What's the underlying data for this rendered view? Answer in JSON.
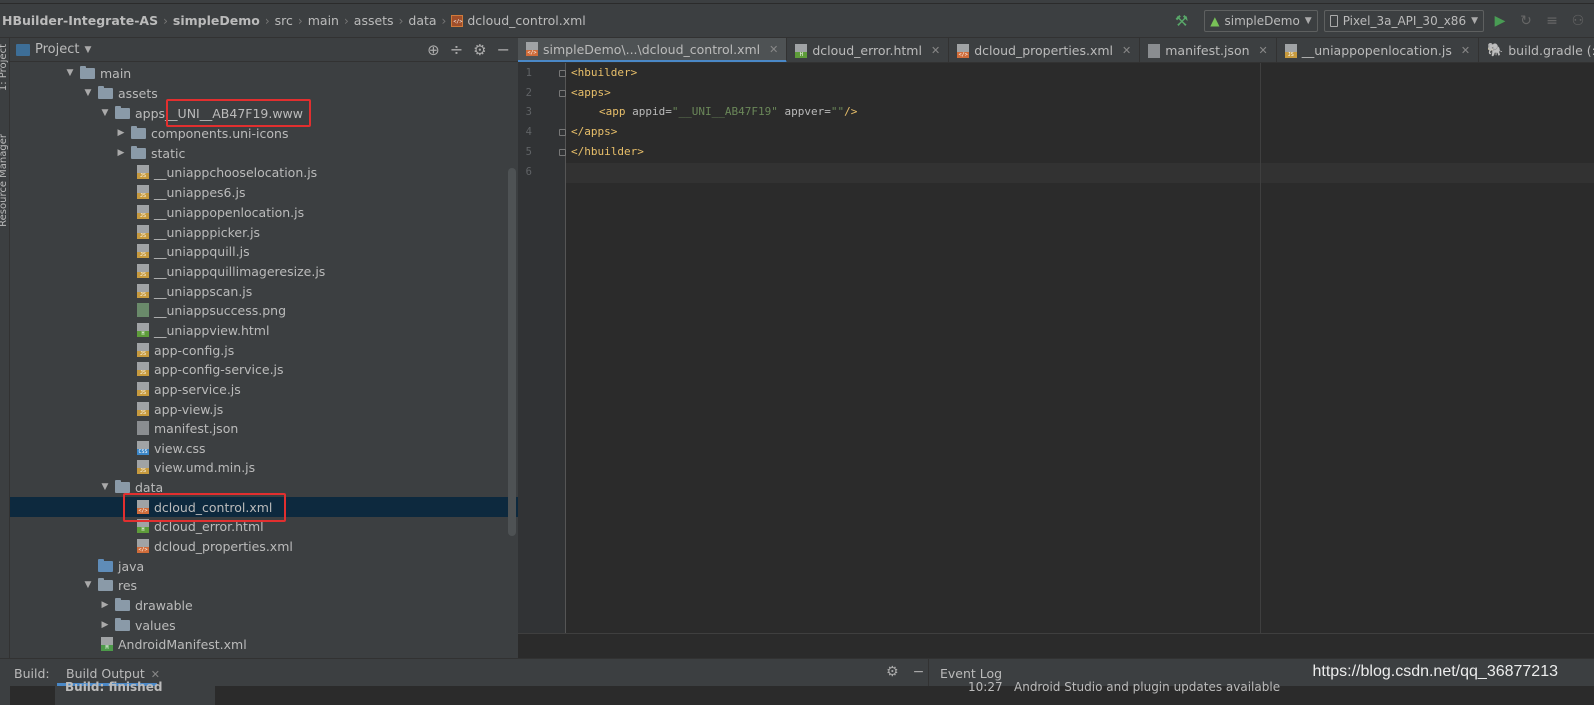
{
  "breadcrumbs": [
    {
      "label": "HBuilder-Integrate-AS",
      "bold": true
    },
    {
      "label": "simpleDemo",
      "bold": true
    },
    {
      "label": "src"
    },
    {
      "label": "main"
    },
    {
      "label": "assets"
    },
    {
      "label": "data"
    },
    {
      "label": "dcloud_control.xml"
    }
  ],
  "toolbar": {
    "run_config": "simpleDemo",
    "device": "Pixel_3a_API_30_x86"
  },
  "left_strip": {
    "project_label": "1: Project",
    "resource_label": "Resource Manager"
  },
  "project_panel": {
    "title": "Project"
  },
  "tree": [
    {
      "label": "main",
      "type": "folder"
    },
    {
      "label": "assets",
      "type": "folder"
    },
    {
      "label": "apps",
      "suffix": "__UNI__AB47F19.www",
      "type": "folder"
    },
    {
      "label": "components.uni-icons",
      "type": "folder"
    },
    {
      "label": "static",
      "type": "folder"
    },
    {
      "label": "__uniappchooselocation.js",
      "type": "js"
    },
    {
      "label": "__uniappes6.js",
      "type": "js"
    },
    {
      "label": "__uniappopenlocation.js",
      "type": "js"
    },
    {
      "label": "__uniapppicker.js",
      "type": "js"
    },
    {
      "label": "__uniappquill.js",
      "type": "js"
    },
    {
      "label": "__uniappquillimageresize.js",
      "type": "js"
    },
    {
      "label": "__uniappscan.js",
      "type": "js"
    },
    {
      "label": "__uniappsuccess.png",
      "type": "png"
    },
    {
      "label": "__uniappview.html",
      "type": "html"
    },
    {
      "label": "app-config.js",
      "type": "js"
    },
    {
      "label": "app-config-service.js",
      "type": "js"
    },
    {
      "label": "app-service.js",
      "type": "js"
    },
    {
      "label": "app-view.js",
      "type": "js"
    },
    {
      "label": "manifest.json",
      "type": "json"
    },
    {
      "label": "view.css",
      "type": "css"
    },
    {
      "label": "view.umd.min.js",
      "type": "js"
    },
    {
      "label": "data",
      "type": "folder"
    },
    {
      "label": "dcloud_control.xml",
      "type": "xml"
    },
    {
      "label": "dcloud_error.html",
      "type": "html"
    },
    {
      "label": "dcloud_properties.xml",
      "type": "xml"
    },
    {
      "label": "java",
      "type": "folder"
    },
    {
      "label": "res",
      "type": "folder"
    },
    {
      "label": "drawable",
      "type": "folder"
    },
    {
      "label": "values",
      "type": "folder"
    },
    {
      "label": "AndroidManifest.xml",
      "type": "manifest"
    }
  ],
  "tabs": [
    {
      "label": "simpleDemo\\...\\dcloud_control.xml",
      "type": "xml"
    },
    {
      "label": "dcloud_error.html",
      "type": "html"
    },
    {
      "label": "dcloud_properties.xml",
      "type": "xml"
    },
    {
      "label": "manifest.json",
      "type": "json"
    },
    {
      "label": "__uniappopenlocation.js",
      "type": "js"
    },
    {
      "label": "build.gradle (:simpleDe",
      "type": "gradle"
    }
  ],
  "editor": {
    "line_numbers": [
      "1",
      "2",
      "3",
      "4",
      "5",
      "6"
    ],
    "code": {
      "l1": "<hbuilder>",
      "l2": "<apps>",
      "l3_open": "<app ",
      "l3_attr1": "appid=",
      "l3_val1": "\"__UNI__AB47F19\"",
      "l3_attr2": " appver=",
      "l3_val2": "\"\"",
      "l3_close": "/>",
      "l4": "</apps>",
      "l5": "</hbuilder>"
    }
  },
  "bottom": {
    "build_label": "Build:",
    "build_output_tab": "Build Output",
    "event_log": "Event Log",
    "build_status": "Build: finished",
    "event_time": "10:27",
    "event_message": "Android Studio and plugin updates available"
  },
  "watermark": "https://blog.csdn.net/qq_36877213",
  "colors": {
    "highlight": "#e22f2f",
    "selection": "#0d293e",
    "tag": "#e8bf6a",
    "string": "#6a8759"
  }
}
